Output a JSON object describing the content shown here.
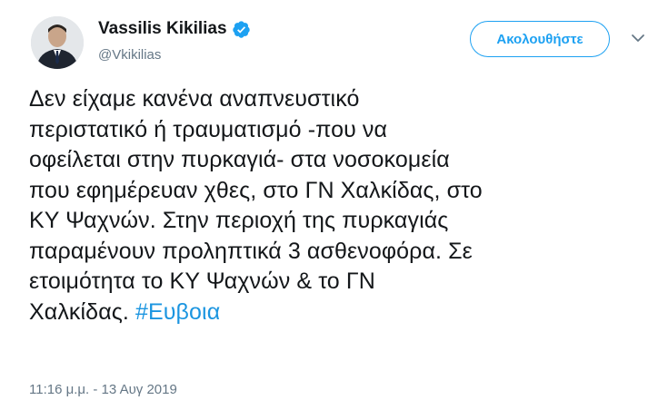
{
  "author": {
    "name": "Vassilis Kikilias",
    "handle": "@Vkikilias",
    "verified": true
  },
  "follow_button": {
    "label": "Ακολουθήστε"
  },
  "menu": {
    "icon": "chevron-down-icon"
  },
  "tweet": {
    "lines": [
      "Δεν είχαμε κανένα αναπνευστικό",
      "περιστατικό ή τραυματισμό -που να",
      "οφείλεται στην πυρκαγιά- στα νοσοκομεία",
      "που εφημέρευαν χθες, στο ΓΝ Χαλκίδας, στο",
      "ΚΥ Ψαχνών. Στην περιοχή της πυρκαγιάς",
      "παραμένουν προληπτικά 3 ασθενοφόρα. Σε",
      "ετοιμότητα το ΚΥ Ψαχνών & το ΓΝ"
    ],
    "last_line_text": "Χαλκίδας. ",
    "hashtag": "#Ευβοια",
    "timestamp": "11:16 μ.μ. - 13 Αυγ 2019"
  },
  "colors": {
    "accent": "#1da1f2",
    "hashtag": "#1b95e0",
    "text": "#14171a",
    "secondary": "#657786"
  }
}
